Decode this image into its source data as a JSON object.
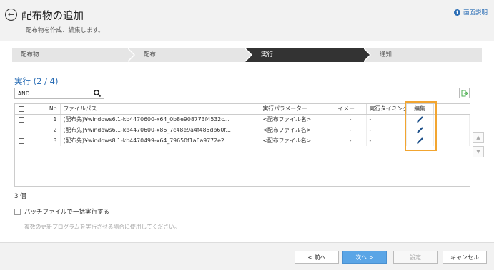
{
  "header": {
    "title": "配布物の追加",
    "subtitle": "配布物を作成、編集します。",
    "help_label": "画面説明"
  },
  "steps": [
    {
      "label": "配布物",
      "active": false
    },
    {
      "label": "配布",
      "active": false
    },
    {
      "label": "実行",
      "active": true
    },
    {
      "label": "通知",
      "active": false
    }
  ],
  "section": {
    "title": "実行 (2 / 4)"
  },
  "search": {
    "value": "AND"
  },
  "table": {
    "columns": [
      "No",
      "ファイルパス",
      "実行パラメーター",
      "イメー...",
      "実行タイミング",
      "編集"
    ],
    "rows": [
      {
        "no": "1",
        "path": "(配布先)¥windows6.1-kb4470600-x64_0b8e908773f4532c...",
        "param": "<配布ファイル名>",
        "image": "-",
        "timing": "-"
      },
      {
        "no": "2",
        "path": "(配布先)¥windows6.1-kb4470600-x86_7c48e9a4f485db60f...",
        "param": "<配布ファイル名>",
        "image": "-",
        "timing": "-"
      },
      {
        "no": "3",
        "path": "(配布先)¥windows8.1-kb4470499-x64_79650f1a6a9772e2...",
        "param": "<配布ファイル名>",
        "image": "-",
        "timing": "-"
      }
    ]
  },
  "count_label": "3 個",
  "batch": {
    "label": "バッチファイルで一括実行する",
    "checked": false
  },
  "note": "複数の更新プログラムを実行させる場合に使用してください。",
  "footer": {
    "prev_label": "< 前へ",
    "next_label": "次へ >",
    "settings_label": "設定",
    "cancel_label": "キャンセル"
  },
  "colors": {
    "accent": "#2a6db5",
    "primary_button": "#5aa5e6",
    "highlight": "#f2a530"
  }
}
